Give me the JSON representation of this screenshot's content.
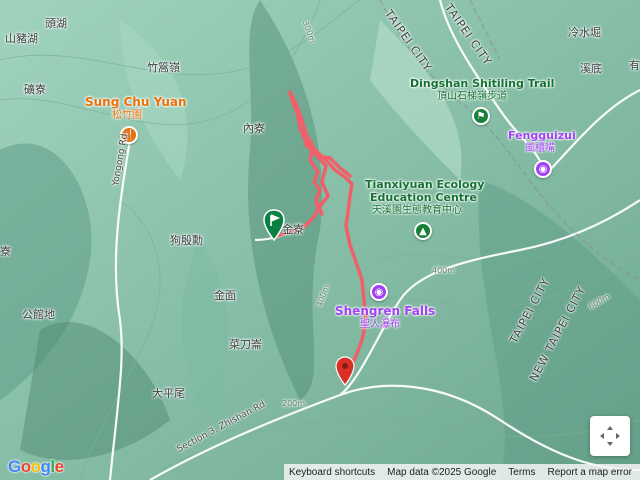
{
  "labels": {
    "toutun_hu": "頭湖",
    "shanzhu_hu": "山豬湖",
    "zhuzi_hu_ridge": "竹篙嶺",
    "jian_liao": "礦寮",
    "nei_liao": "內寮",
    "gou_dian_dong": "狗殷勳",
    "jin_mian": "金面",
    "gong_guan_di": "公館地",
    "cai_dao_lun": "菜刀崙",
    "da_ping_wei": "大平尾",
    "jin_liao": "金寮",
    "leng_shui_keng": "冷水堀",
    "xi_di": "溪底",
    "liao_label": "寮",
    "you_label": "有"
  },
  "poi": {
    "sung_chu_yuan_en": "Sung Chu Yuan",
    "sung_chu_yuan_zh": "松竹園",
    "dingshan_en": "Dingshan Shitiling Trail",
    "dingshan_zh": "頂山石梯嶺步道",
    "fengguizui_en": "Fengguizui",
    "fengguizui_zh": "風櫃嘴",
    "tianxiyuan_en1": "Tianxiyuan Ecology",
    "tianxiyuan_en2": "Education Centre",
    "tianxiyuan_zh": "天溪園生態教育中心",
    "shengren_en": "Shengren Falls",
    "shengren_zh": "聖人瀑布"
  },
  "roads": {
    "yongong_rd": "Yongong Rd",
    "zhishan_rd": "Section 3, Zhishan Rd"
  },
  "boundaries": {
    "taipei_city_1": "TAIPEI CITY",
    "taipei_city_2": "TAIPEI CITY",
    "taipei_city_3": "TAIPEI CITY",
    "new_taipei_city": "NEW TAIPEI CITY"
  },
  "contours": {
    "c300_top": "300m",
    "c400_mid": "400m",
    "c400_right": "400m",
    "c200_bottom": "200m",
    "c600_right": "600m"
  },
  "footer": {
    "keyboard": "Keyboard shortcuts",
    "map_data": "Map data ©2025 Google",
    "terms": "Terms",
    "report": "Report a map error"
  },
  "logo": "Google",
  "colors": {
    "track": "#f0606a",
    "start_flag": "#0b8043",
    "end_pin": "#d93025",
    "restaurant": "#e8710a",
    "park": "#188038",
    "attraction": "#a142f4"
  }
}
